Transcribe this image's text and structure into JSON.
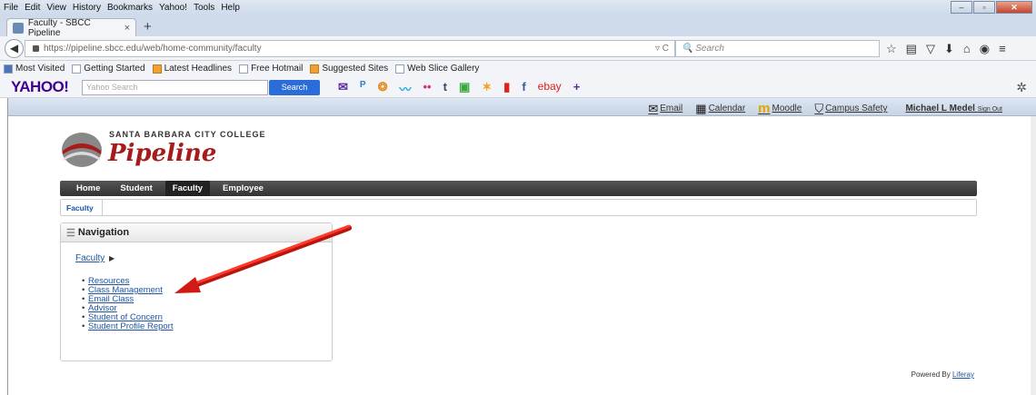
{
  "menu": [
    "File",
    "Edit",
    "View",
    "History",
    "Bookmarks",
    "Yahoo!",
    "Tools",
    "Help"
  ],
  "tab": {
    "title": "Faculty - SBCC Pipeline",
    "close": "×",
    "new": "+"
  },
  "url": {
    "host": "https://pipeline.sbcc.edu",
    "path": "/web/home-community/faculty",
    "search_placeholder": "Search"
  },
  "bookmarks": [
    "Most Visited",
    "Getting Started",
    "Latest Headlines",
    "Free Hotmail",
    "Suggested Sites",
    "Web Slice Gallery"
  ],
  "yahoo": {
    "logo": "YAHOO!",
    "placeholder": "Yahoo Search",
    "button": "Search",
    "icons": [
      "✉",
      "P",
      "❂",
      "〰",
      "••",
      "t",
      "▣",
      "✶",
      "▮",
      "f",
      "ebay",
      "+"
    ]
  },
  "dock": {
    "email": "Email",
    "calendar": "Calendar",
    "moodle": "Moodle",
    "safety": "Campus Safety",
    "user": "Michael L Medel",
    "signout": "Sign Out"
  },
  "brand": {
    "college": "SANTA BARBARA CITY COLLEGE",
    "name": "Pipeline"
  },
  "nav": {
    "home": "Home",
    "student": "Student",
    "faculty": "Faculty",
    "employee": "Employee"
  },
  "breadcrumb": "Faculty",
  "portlet": {
    "title": "Navigation",
    "parent": "Faculty",
    "links": [
      "Resources",
      "Class Management",
      "Email Class",
      "Advisor",
      "Student of Concern",
      "Student Profile Report"
    ]
  },
  "footer": {
    "prefix": "Powered By",
    "link": "Liferay"
  },
  "colors": {
    "brand_red": "#a61c1c",
    "link": "#1c55a3",
    "arrow": "#e0201a"
  }
}
